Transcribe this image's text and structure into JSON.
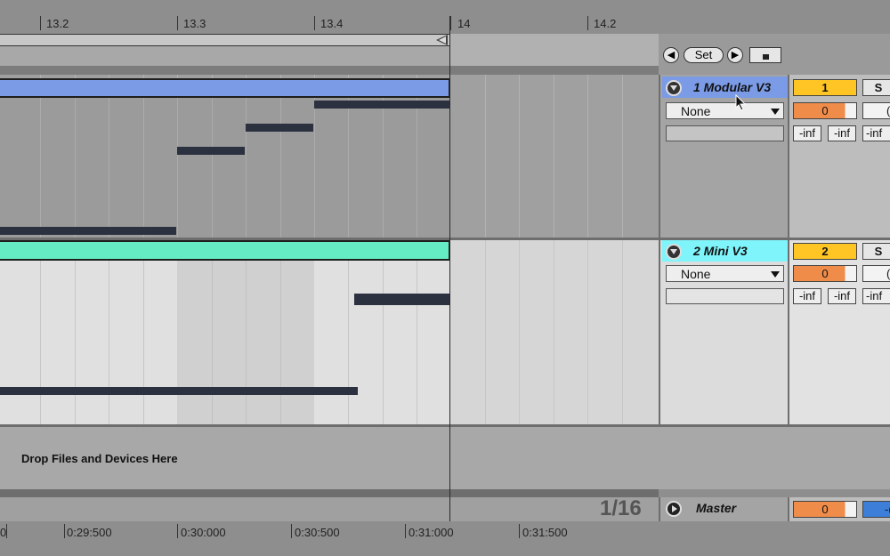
{
  "ruler": {
    "bar_labels": [
      "13.2",
      "13.3",
      "13.4",
      "14",
      "14.2"
    ]
  },
  "loop_controls": {
    "set_label": "Set"
  },
  "tracks": [
    {
      "name": "1 Modular V3",
      "input": "None",
      "number": "1",
      "solo": "S",
      "volume": "0",
      "pan_partial": "(",
      "meters": [
        "-inf",
        "-inf",
        "-inf"
      ],
      "clip_color": "#7b9be6",
      "header_color": "#7b9be6"
    },
    {
      "name": "2 Mini V3",
      "input": "None",
      "number": "2",
      "solo": "S",
      "volume": "0",
      "pan_partial": "(",
      "meters": [
        "-inf",
        "-inf",
        "-inf"
      ],
      "clip_color": "#66ecc4",
      "header_color": "#7ff5fb"
    }
  ],
  "drop_area": {
    "text": "Drop Files and Devices Here"
  },
  "master": {
    "name": "Master",
    "volume": "0",
    "pan_partial": "-("
  },
  "grid": {
    "quantization": "1/16"
  },
  "time_ruler": {
    "labels": [
      "0",
      "0:29:500",
      "0:30:000",
      "0:30:500",
      "0:31:000",
      "0:31:500"
    ]
  },
  "colors": {
    "orange": "#f08c4a",
    "yellow": "#ffc524",
    "blue_meter": "#3d7fd8"
  }
}
